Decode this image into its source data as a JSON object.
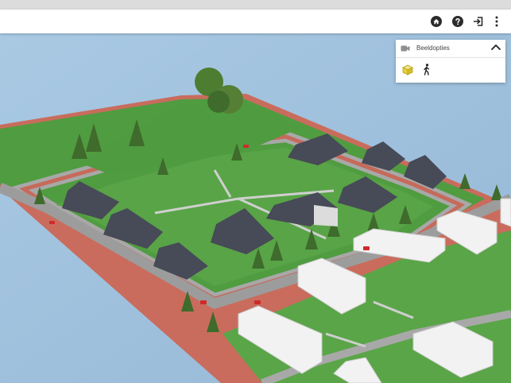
{
  "toolbar": {
    "icons": [
      "home-icon",
      "help-icon",
      "logout-icon",
      "more-vertical-icon"
    ]
  },
  "view_panel": {
    "title": "Beeldopties",
    "header_icon": "video-camera-icon",
    "collapse_icon": "chevron-up-icon",
    "options": [
      "cube-3d-view-icon",
      "walking-person-icon"
    ]
  },
  "colors": {
    "water": "#9fc2de",
    "grass": "#4f9b3f",
    "road": "#a8a8a8",
    "pavement": "#c86a5a",
    "roof": "#474a57",
    "brick": "#8a3f2c",
    "accent_yellow": "#e5d23a"
  }
}
